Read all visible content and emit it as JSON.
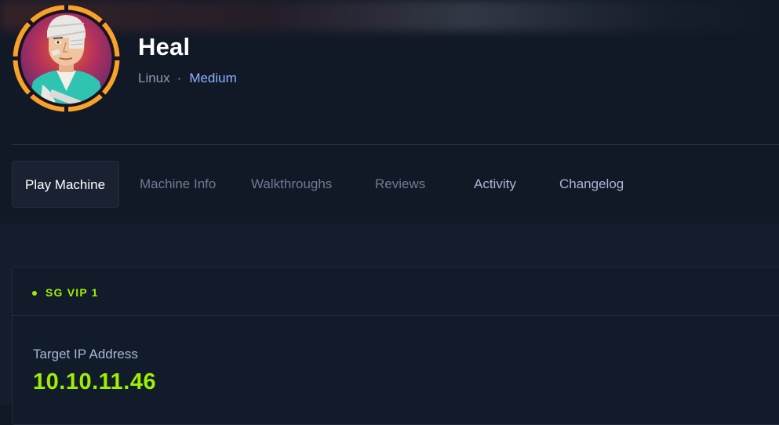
{
  "machine": {
    "name": "Heal",
    "os": "Linux",
    "separator": "·",
    "difficulty": "Medium"
  },
  "tabs": [
    {
      "label": "Play Machine",
      "active": true
    },
    {
      "label": "Machine Info",
      "active": false
    },
    {
      "label": "Walkthroughs",
      "active": false
    },
    {
      "label": "Reviews",
      "active": false
    },
    {
      "label": "Activity",
      "active": false
    },
    {
      "label": "Changelog",
      "active": false
    }
  ],
  "server": {
    "name": "SG VIP 1",
    "status_color": "#9fef00"
  },
  "target": {
    "label": "Target IP Address",
    "ip": "10.10.11.46"
  },
  "colors": {
    "background": "#111927",
    "accent_green": "#9fef00",
    "difficulty_blue": "#8fb2ff",
    "avatar_ring": "#f8a22a"
  },
  "icons": {
    "avatar": "bandaged-doctor-avatar",
    "status": "status-dot-icon"
  }
}
